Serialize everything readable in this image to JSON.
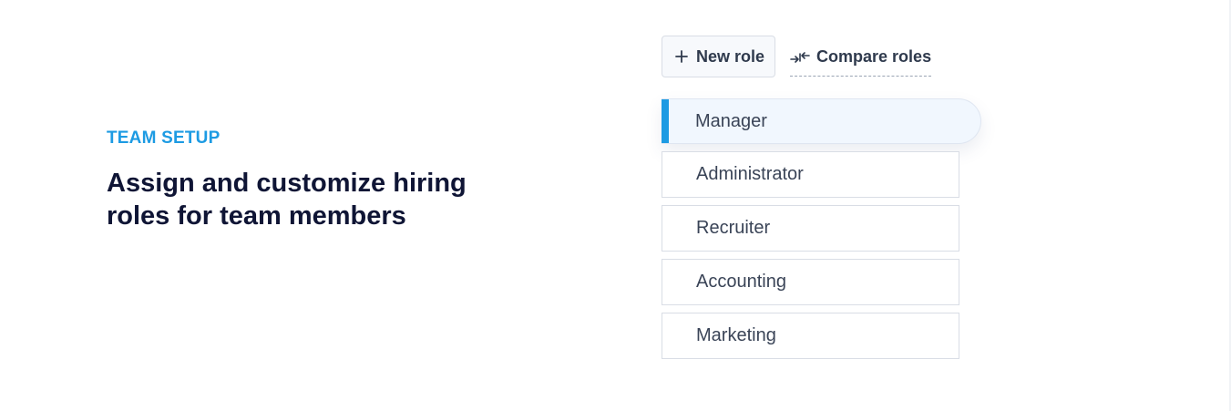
{
  "intro": {
    "eyebrow": "TEAM SETUP",
    "headline": "Assign and customize hiring roles for team members"
  },
  "toolbar": {
    "new_role_label": "New role",
    "new_role_icon": "plus-icon",
    "compare_label": "Compare roles",
    "compare_icon": "compare-arrows-icon"
  },
  "roles": [
    {
      "label": "Manager",
      "active": true
    },
    {
      "label": "Administrator",
      "active": false
    },
    {
      "label": "Recruiter",
      "active": false
    },
    {
      "label": "Accounting",
      "active": false
    },
    {
      "label": "Marketing",
      "active": false
    }
  ],
  "colors": {
    "accent": "#1d9be3",
    "heading": "#0f1535",
    "text": "#3a4457",
    "active_bg": "#f1f7fe",
    "border": "#d9dde5"
  }
}
